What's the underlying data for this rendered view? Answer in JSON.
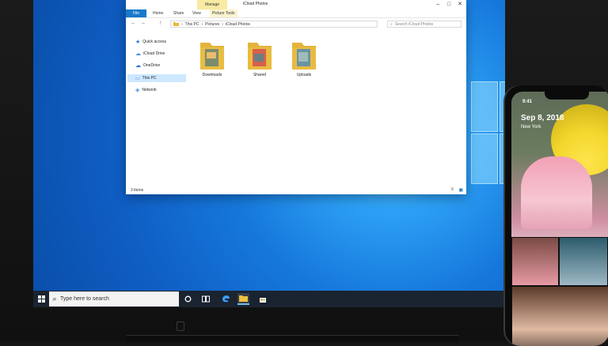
{
  "explorer": {
    "title": "iCloud Photos",
    "manage_tab": "Manage",
    "controls": [
      "–",
      "□",
      "✕"
    ],
    "ribbon_tabs": [
      "File",
      "Home",
      "Share",
      "View",
      "Picture Tools"
    ],
    "breadcrumb": [
      "This PC",
      "Pictures",
      "iCloud Photos"
    ],
    "search_placeholder": "Search iCloud Photos",
    "nav": [
      {
        "label": "Quick access",
        "icon": "star-icon"
      },
      {
        "label": "iCloud Drive",
        "icon": "cloud-icon"
      },
      {
        "label": "OneDrive",
        "icon": "onedrive-icon"
      },
      {
        "label": "This PC",
        "icon": "pc-icon",
        "selected": true
      },
      {
        "label": "Network",
        "icon": "network-icon"
      }
    ],
    "folders": [
      "Downloads",
      "Shared",
      "Uploads"
    ],
    "status": "3 items"
  },
  "taskbar": {
    "search_placeholder": "Type here to search"
  },
  "phone": {
    "time": "9:41",
    "date": "Sep 8, 2018",
    "location": "New York"
  }
}
